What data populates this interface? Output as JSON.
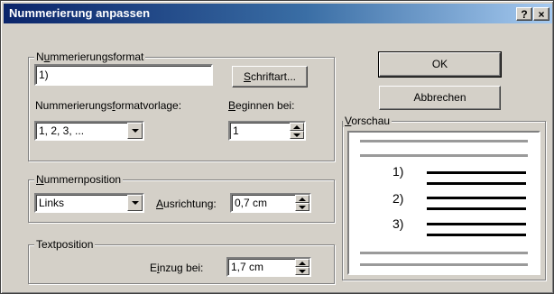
{
  "dialog": {
    "title": "Nummerierung anpassen",
    "help_label": "?",
    "close_label": "×"
  },
  "format_group": {
    "legend_pre": "N",
    "legend_underline": "u",
    "legend_post": "mmerierungsformat",
    "format_value": "1)",
    "font_button_pre": "",
    "font_button_underline": "S",
    "font_button_post": "chriftart...",
    "template_label_pre": "Nummerierungs",
    "template_label_underline": "f",
    "template_label_post": "ormatvorlage:",
    "template_value": "1, 2, 3, ...",
    "start_label_pre": "",
    "start_label_underline": "B",
    "start_label_post": "eginnen bei:",
    "start_value": "1"
  },
  "position_group": {
    "legend_pre": "",
    "legend_underline": "N",
    "legend_post": "ummernposition",
    "alignment_value": "Links",
    "alignment_label_pre": "",
    "alignment_label_underline": "A",
    "alignment_label_post": "usrichtung:",
    "alignment_distance": "0,7 cm"
  },
  "text_group": {
    "legend": "Textposition",
    "indent_label_pre": "E",
    "indent_label_underline": "i",
    "indent_label_post": "nzug bei:",
    "indent_value": "1,7 cm"
  },
  "buttons": {
    "ok": "OK",
    "cancel": "Abbrechen"
  },
  "preview": {
    "legend_pre": "",
    "legend_underline": "V",
    "legend_post": "orschau",
    "numbers": [
      "1)",
      "2)",
      "3)"
    ]
  }
}
